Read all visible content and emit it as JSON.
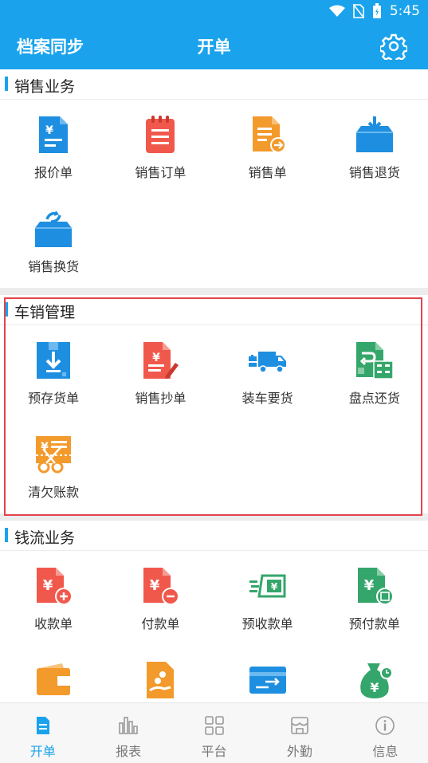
{
  "status": {
    "time": "5:45"
  },
  "appbar": {
    "left_label": "档案同步",
    "title": "开单"
  },
  "sections": [
    {
      "title": "销售业务",
      "items": [
        "报价单",
        "销售订单",
        "销售单",
        "销售退货",
        "销售换货"
      ]
    },
    {
      "title": "车销管理",
      "items": [
        "预存货单",
        "销售抄单",
        "装车要货",
        "盘点还货",
        "清欠账款"
      ]
    },
    {
      "title": "钱流业务",
      "items": [
        "收款单",
        "付款单",
        "预收款单",
        "预付款单"
      ]
    }
  ],
  "tabs": [
    {
      "label": "开单",
      "icon": "document-icon"
    },
    {
      "label": "报表",
      "icon": "bar-chart-icon"
    },
    {
      "label": "平台",
      "icon": "grid-icon"
    },
    {
      "label": "外勤",
      "icon": "shop-icon"
    },
    {
      "label": "信息",
      "icon": "info-icon"
    }
  ],
  "colors": {
    "primary": "#1aa3ec",
    "highlight": "#e5434c",
    "red": "#f1584c",
    "orange": "#f39a2c",
    "green": "#35a66b",
    "blue": "#1e8fe0"
  }
}
